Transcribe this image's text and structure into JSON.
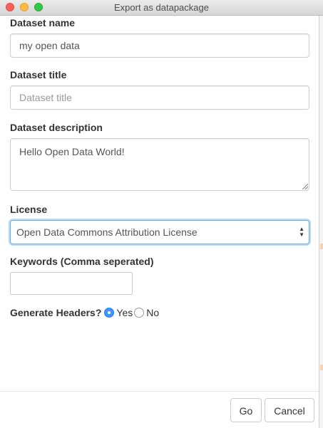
{
  "window": {
    "title": "Export as datapackage"
  },
  "form": {
    "dataset_name_label": "Dataset name",
    "dataset_name_value": "my open data",
    "dataset_title_label": "Dataset title",
    "dataset_title_placeholder": "Dataset title",
    "dataset_description_label": "Dataset description",
    "dataset_description_value": "Hello Open Data World!",
    "license_label": "License",
    "license_selected": "Open Data Commons Attribution License",
    "keywords_label": "Keywords (Comma seperated)",
    "keywords_value": "",
    "headers_label": "Generate Headers?",
    "headers_yes": "Yes",
    "headers_no": "No",
    "headers_selected": "Yes"
  },
  "footer": {
    "go_label": "Go",
    "cancel_label": "Cancel"
  },
  "colors": {
    "focus_border": "#66afe9",
    "radio_selected": "#3b97fa"
  }
}
